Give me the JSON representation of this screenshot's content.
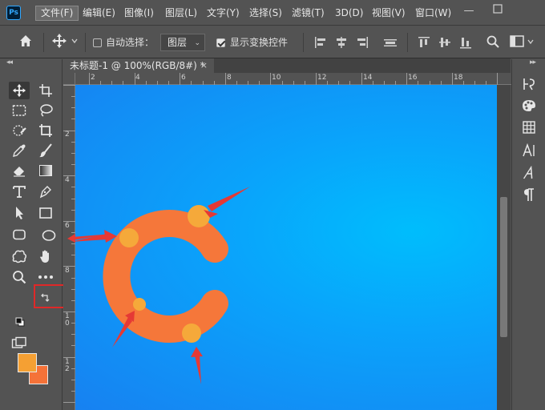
{
  "app": {
    "logo": "Ps"
  },
  "menubar": {
    "items": [
      {
        "label": "文件(F)",
        "active": true
      },
      {
        "label": "编辑(E)"
      },
      {
        "label": "图像(I)"
      },
      {
        "label": "图层(L)"
      },
      {
        "label": "文字(Y)"
      },
      {
        "label": "选择(S)"
      },
      {
        "label": "滤镜(T)"
      },
      {
        "label": "3D(D)"
      },
      {
        "label": "视图(V)"
      },
      {
        "label": "窗口(W)"
      }
    ],
    "window_controls": [
      "minimize-icon",
      "maximize-icon"
    ]
  },
  "options": {
    "auto_select_label": "自动选择：",
    "auto_select_checked": false,
    "layer_dropdown_value": "图层",
    "show_transform_label": "显示变换控件",
    "show_transform_checked": true
  },
  "document": {
    "tab_title": "未标题-1 @ 100%(RGB/8#) *",
    "close_symbol": "×"
  },
  "ruler": {
    "top_labels": [
      "2",
      "4",
      "6",
      "8",
      "10",
      "12",
      "14",
      "16",
      "18"
    ],
    "left_labels": [
      "2",
      "4",
      "6",
      "8",
      "1\n0",
      "1\n2"
    ]
  },
  "colors": {
    "foreground": "#f5a033",
    "background": "#f57238",
    "canvas_gradient_center": "#00bdfc",
    "canvas_gradient_edge": "#1781f1",
    "letter_fill": "#f5773a",
    "dot_fill": "#f5a93a",
    "arrow_color": "#e53935",
    "highlight_color": "#e02828"
  },
  "canvas_art": {
    "letter": "C",
    "annotation_arrow_count": 4,
    "annotation_dot_count": 4
  }
}
